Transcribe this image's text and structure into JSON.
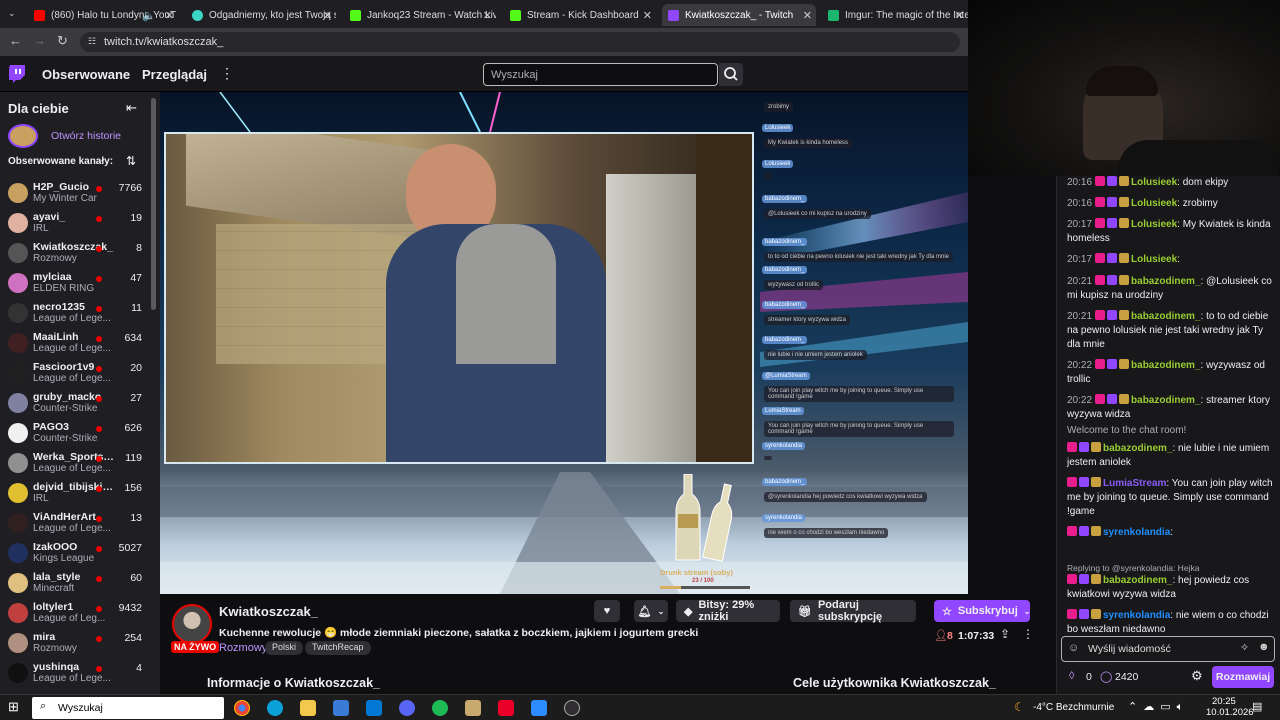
{
  "browser": {
    "tabs": [
      {
        "title": "(860) Halo tu Londyn - YouT",
        "color": "#ff0000"
      },
      {
        "title": "Odgadniemy, kto jest Twoją sek",
        "color": "#3dd6c6"
      },
      {
        "title": "Jankoq23 Stream - Watch Live",
        "color": "#53fc18"
      },
      {
        "title": "Stream - Kick Dashboard",
        "color": "#53fc18"
      },
      {
        "title": "Kwiatkoszczak_ - Twitch",
        "color": "#9146ff"
      },
      {
        "title": "Imgur: The magic of the Interne",
        "color": "#1bb76e"
      }
    ],
    "url": "twitch.tv/kwiatkoszczak_"
  },
  "topnav": {
    "following": "Obserwowane",
    "browse": "Przeglądaj",
    "search_placeholder": "Wyszukaj"
  },
  "sidebar": {
    "for_you": "Dla ciebie",
    "open_stories": "Otwórz historie",
    "followed_header": "Obserwowane kanały:",
    "channels": [
      {
        "name": "H2P_Gucio",
        "game": "My Winter Car",
        "viewers": "7766",
        "color": "#c8a060"
      },
      {
        "name": "ayavi_",
        "game": "IRL",
        "viewers": "19",
        "color": "#e0b0a0"
      },
      {
        "name": "Kwiatkoszczak_",
        "game": "Rozmowy",
        "viewers": "8",
        "color": "#555"
      },
      {
        "name": "mylciaa",
        "game": "ELDEN RING",
        "viewers": "47",
        "color": "#d070c0"
      },
      {
        "name": "necro1235",
        "game": "League of Lege...",
        "viewers": "11",
        "color": "#333"
      },
      {
        "name": "MaaiLinh",
        "game": "League of Lege...",
        "viewers": "634",
        "color": "#402020"
      },
      {
        "name": "Fascioor1v9",
        "game": "League of Lege...",
        "viewers": "20",
        "color": "#202020"
      },
      {
        "name": "gruby_macko",
        "game": "Counter-Strike",
        "viewers": "27",
        "color": "#8080a0"
      },
      {
        "name": "PAGO3",
        "game": "Counter-Strike",
        "viewers": "626",
        "color": "#f0f0f0"
      },
      {
        "name": "Werka_Sportsm...",
        "game": "League of Lege...",
        "viewers": "119",
        "color": "#909090"
      },
      {
        "name": "dejvid_tibijski_...",
        "game": "IRL",
        "viewers": "156",
        "color": "#e0c030"
      },
      {
        "name": "ViAndHerArt",
        "game": "League of Lege...",
        "viewers": "13",
        "color": "#302020"
      },
      {
        "name": "IzakOOO",
        "game": "Kings League",
        "viewers": "5027",
        "color": "#203060"
      },
      {
        "name": "lala_style",
        "game": "Minecraft",
        "viewers": "60",
        "color": "#e0c080"
      },
      {
        "name": "loltyler1",
        "game": "League of Leg...",
        "viewers": "9432",
        "color": "#c04040"
      },
      {
        "name": "mira",
        "game": "Rozmowy",
        "viewers": "254",
        "color": "#b09080"
      },
      {
        "name": "yushinqa",
        "game": "League of Lege...",
        "viewers": "4",
        "color": "#101010"
      }
    ]
  },
  "player_overlay": {
    "chat": [
      {
        "text": "zrobimy"
      },
      {
        "name": "Lolusieek",
        "text": "My Kwiatek is kinda homeless"
      },
      {
        "name": "Lolusieek",
        "text": ""
      },
      {
        "name": "babazodinem_",
        "text": "@Lolusieek co mi kupisz na urodziny"
      },
      {
        "name": "babazodinem_",
        "text": "to to od ciebie na pewno lolusiek nie jest taki wredny jak Ty dla mnie"
      },
      {
        "name": "babazodinem_",
        "text": "wyzywasz od trollic"
      },
      {
        "name": "babazodinem_",
        "text": "streamer ktory wyzywa widza"
      },
      {
        "name": "babazodinem_",
        "text": "nie lubie i nie umiem jestem aniolek"
      },
      {
        "name": "@LumiaStream",
        "text": "You can join play witch me by joining to queue. Simply use command !game"
      },
      {
        "name": "LumiaStream",
        "text": "You can join play witch me by joining to queue. Simply use command !game"
      },
      {
        "name": "syrenkolandia",
        "text": ""
      },
      {
        "name": "babazodinem_",
        "text": "@syrenkolandia hej powiedz cos kwiatkowi wyzywa widza"
      },
      {
        "name": "syrenkolandia",
        "text": "nie wiem o co chodzi bo weszłam niedawno"
      }
    ],
    "goal_label": "Drunk stream (soby)",
    "goal_value": "23 / 100",
    "goal_fraction": 0.23
  },
  "stream_info": {
    "channel": "Kwiatkoszczak_",
    "title": "Kuchenne rewolucje 😁 młode ziemniaki pieczone, sałatka z boczkiem, jajkiem i jogurtem greckim",
    "category": "Rozmowy",
    "tags": [
      "Polski",
      "TwitchRecap"
    ],
    "live": "NA ŻYWO",
    "bits": "Bitsy: 29% zniżki",
    "gift": "Podaruj subskrypcję",
    "subscribe": "Subskrybuj",
    "viewers": "8",
    "uptime": "1:07:33",
    "about": "Informacje o Kwiatkoszczak_",
    "goals": "Cele użytkownika Kwiatkoszczak_"
  },
  "chat": {
    "messages": [
      {
        "time": "20:16",
        "name": "Lolusieek",
        "color": "#9acd32",
        "text": "dom ekipy"
      },
      {
        "time": "20:16",
        "name": "Lolusieek",
        "color": "#9acd32",
        "text": "zrobimy"
      },
      {
        "time": "20:17",
        "name": "Lolusieek",
        "color": "#9acd32",
        "text": "My Kwiatek is kinda homeless"
      },
      {
        "time": "20:17",
        "name": "Lolusieek",
        "color": "#9acd32",
        "text": ""
      },
      {
        "time": "20:21",
        "name": "babazodinem_",
        "color": "#9acd32",
        "text": "@Lolusieek co mi kupisz na urodziny"
      },
      {
        "time": "20:21",
        "name": "babazodinem_",
        "color": "#9acd32",
        "text": "to to od ciebie na pewno lolusiek nie jest taki wredny jak Ty dla mnie"
      },
      {
        "time": "20:22",
        "name": "babazodinem_",
        "color": "#9acd32",
        "text": "wyzywasz od trollic"
      },
      {
        "time": "20:22",
        "name": "babazodinem_",
        "color": "#9acd32",
        "text": "streamer ktory wyzywa widza"
      }
    ],
    "welcome": "Welcome to the chat room!",
    "messages2": [
      {
        "name": "babazodinem_",
        "color": "#9acd32",
        "text": "nie lubie i nie umiem jestem aniolek"
      },
      {
        "name": "LumiaStream",
        "color": "#8a5cf6",
        "text": "You can join play witch me by joining to queue. Simply use command !game"
      },
      {
        "name": "syrenkolandia",
        "color": "#1e90ff",
        "text": ""
      }
    ],
    "reply_note": "Replying to @syrenkolandia: Hejka",
    "messages3": [
      {
        "name": "babazodinem_",
        "color": "#9acd32",
        "text": "hej powiedz cos kwiatkowi wyzywa widza"
      },
      {
        "name": "syrenkolandia",
        "color": "#1e90ff",
        "text": "nie wiem o co chodzi bo weszłam niedawno"
      }
    ],
    "input_placeholder": "Wyślij wiadomość",
    "points_a": "0",
    "points_b": "2420",
    "chat_button": "Rozmawiaj"
  },
  "taskbar": {
    "search": "Wyszukaj",
    "weather": "-4°C  Bezchmurnie",
    "time": "20:25",
    "date": "10.01.2026"
  }
}
